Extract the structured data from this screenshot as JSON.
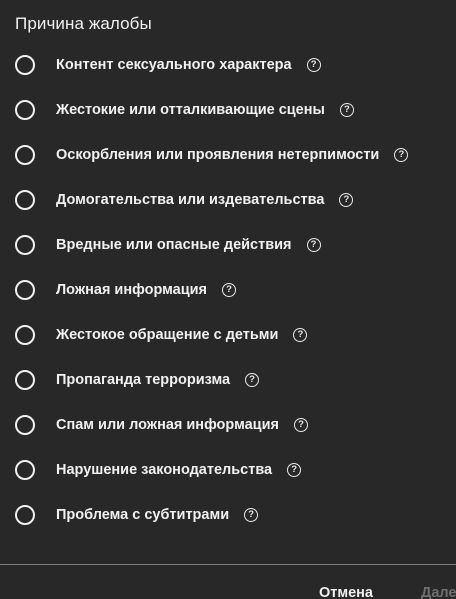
{
  "dialog": {
    "title": "Причина жалобы",
    "help_glyph": "?",
    "options": [
      {
        "label": "Контент сексуального характера"
      },
      {
        "label": "Жестокие или отталкивающие сцены"
      },
      {
        "label": "Оскорбления или проявления нетерпимости"
      },
      {
        "label": "Домогательства или издевательства"
      },
      {
        "label": "Вредные или опасные действия"
      },
      {
        "label": "Ложная информация"
      },
      {
        "label": "Жестокое обращение с детьми"
      },
      {
        "label": "Пропаганда терроризма"
      },
      {
        "label": "Спам или ложная информация"
      },
      {
        "label": "Нарушение законодательства"
      },
      {
        "label": "Проблема с субтитрами"
      }
    ],
    "footer": {
      "cancel_label": "Отмена",
      "next_label": "Далее"
    },
    "colors": {
      "background": "#282828",
      "text": "#f1f1f1",
      "disabled_text": "#6f6f6f"
    }
  }
}
